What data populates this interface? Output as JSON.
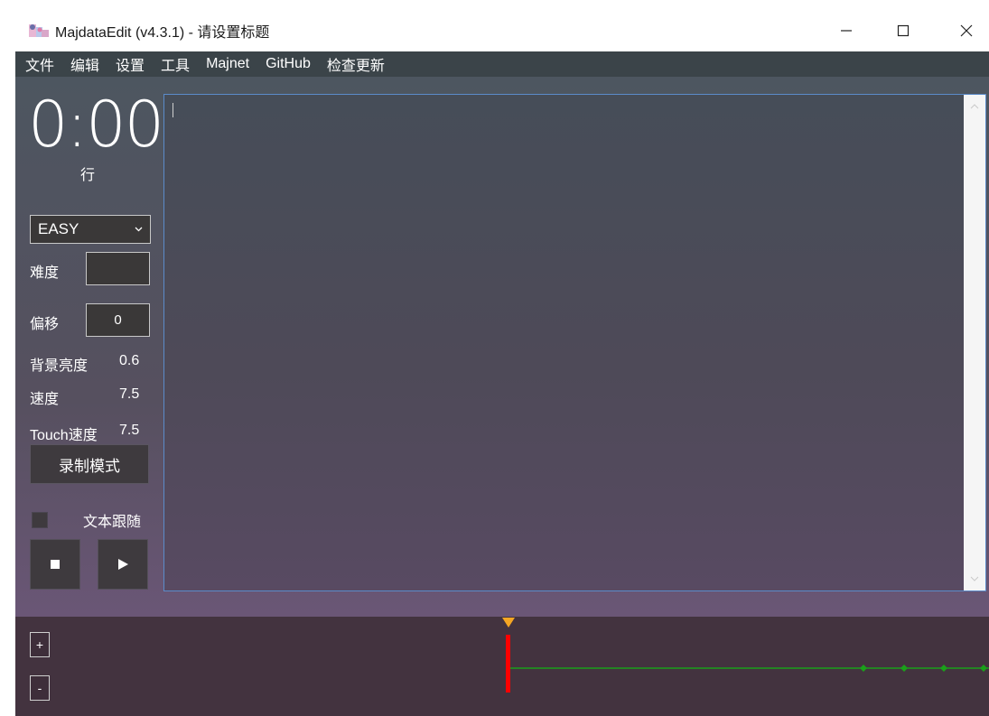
{
  "window": {
    "title": "MajdataEdit (v4.3.1) - 请设置标题",
    "minimize_icon": "minimize-icon",
    "maximize_icon": "maximize-icon",
    "close_icon": "close-icon"
  },
  "menu": {
    "items": [
      "文件",
      "编辑",
      "设置",
      "工具",
      "Majnet",
      "GitHub",
      "检查更新"
    ]
  },
  "left_panel": {
    "time": "0:00",
    "row_label": "行",
    "level": {
      "selected": "EASY",
      "icon": "chevron-down-icon"
    },
    "difficulty": {
      "label": "难度",
      "value": ""
    },
    "offset": {
      "label": "偏移",
      "value": "0"
    },
    "bg_brightness": {
      "label": "背景亮度",
      "value": "0.6"
    },
    "speed": {
      "label": "速度",
      "value": "7.5"
    },
    "touch_speed": {
      "label": "Touch速度",
      "value": "7.5"
    },
    "record_button": "录制模式",
    "follow_text": {
      "label": "文本跟随",
      "checked": false
    },
    "stop_icon": "stop-icon",
    "play_icon": "play-icon"
  },
  "editor": {
    "content": "",
    "scroll_up_icon": "chevron-up-icon",
    "scroll_down_icon": "chevron-down-icon"
  },
  "timeline": {
    "zoom_in": "+",
    "zoom_out": "-",
    "colors": {
      "playhead": "#ff0000",
      "marker": "#f5a623",
      "track": "#1aa01a",
      "background": "#43333f"
    }
  }
}
